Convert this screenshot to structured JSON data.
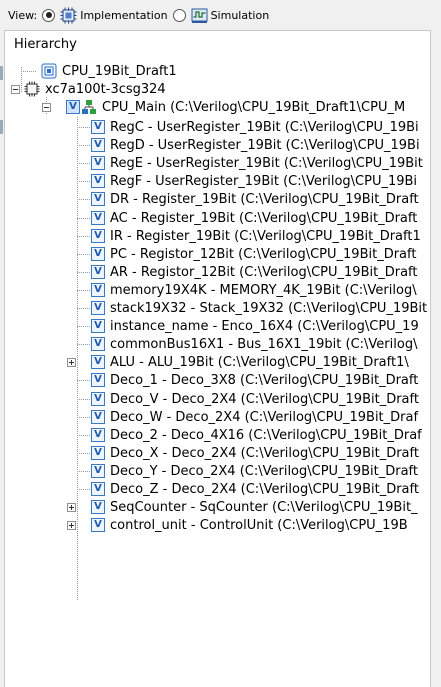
{
  "toolbar": {
    "view_label": "View:",
    "options": [
      {
        "label": "Implementation",
        "selected": true,
        "icon": "implementation-chip-icon"
      },
      {
        "label": "Simulation",
        "selected": false,
        "icon": "simulation-icon"
      }
    ]
  },
  "hierarchy": {
    "heading": "Hierarchy",
    "project": {
      "label": "CPU_19Bit_Draft1",
      "icon": "project-icon"
    },
    "device": {
      "label": "xc7a100t-3csg324",
      "icon": "chip-icon",
      "expanded": true
    },
    "top_module": {
      "label": "CPU_Main (C:\\Verilog\\CPU_19Bit_Draft1\\CPU_M",
      "icon": "verilog-top-module-icon",
      "expanded": true
    },
    "children": [
      {
        "label": "RegC - UserRegister_19Bit (C:\\Verilog\\CPU_19Bi",
        "expandable": false
      },
      {
        "label": "RegD - UserRegister_19Bit (C:\\Verilog\\CPU_19Bi",
        "expandable": false
      },
      {
        "label": "RegE - UserRegister_19Bit (C:\\Verilog\\CPU_19Bit",
        "expandable": false
      },
      {
        "label": "RegF - UserRegister_19Bit (C:\\Verilog\\CPU_19Bi",
        "expandable": false
      },
      {
        "label": "DR - Register_19Bit (C:\\Verilog\\CPU_19Bit_Draft",
        "expandable": false
      },
      {
        "label": "AC - Register_19Bit (C:\\Verilog\\CPU_19Bit_Draft",
        "expandable": false
      },
      {
        "label": "IR - Register_19Bit (C:\\Verilog\\CPU_19Bit_Draft1",
        "expandable": false
      },
      {
        "label": "PC - Registor_12Bit (C:\\Verilog\\CPU_19Bit_Draft",
        "expandable": false
      },
      {
        "label": "AR - Registor_12Bit (C:\\Verilog\\CPU_19Bit_Draft",
        "expandable": false
      },
      {
        "label": "memory19X4K - MEMORY_4K_19Bit (C:\\Verilog\\",
        "expandable": false
      },
      {
        "label": "stack19X32 - Stack_19X32 (C:\\Verilog\\CPU_19Bit",
        "expandable": false
      },
      {
        "label": "instance_name - Enco_16X4 (C:\\Verilog\\CPU_19",
        "expandable": false
      },
      {
        "label": "commonBus16X1 - Bus_16X1_19bit (C:\\Verilog\\",
        "expandable": false
      },
      {
        "label": "ALU - ALU_19Bit (C:\\Verilog\\CPU_19Bit_Draft1\\",
        "expandable": true
      },
      {
        "label": "Deco_1 - Deco_3X8 (C:\\Verilog\\CPU_19Bit_Draft",
        "expandable": false
      },
      {
        "label": "Deco_V - Deco_2X4 (C:\\Verilog\\CPU_19Bit_Draft",
        "expandable": false
      },
      {
        "label": "Deco_W - Deco_2X4 (C:\\Verilog\\CPU_19Bit_Draf",
        "expandable": false
      },
      {
        "label": "Deco_2 - Deco_4X16 (C:\\Verilog\\CPU_19Bit_Draf",
        "expandable": false
      },
      {
        "label": "Deco_X - Deco_2X4 (C:\\Verilog\\CPU_19Bit_Draft",
        "expandable": false
      },
      {
        "label": "Deco_Y - Deco_2X4 (C:\\Verilog\\CPU_19Bit_Draft",
        "expandable": false
      },
      {
        "label": "Deco_Z - Deco_2X4 (C:\\Verilog\\CPU_19Bit_Draft",
        "expandable": false
      },
      {
        "label": "SeqCounter - SqCounter (C:\\Verilog\\CPU_19Bit_",
        "expandable": true
      },
      {
        "label": "control_unit - ControlUnit (C:\\Verilog\\CPU_19B",
        "expandable": true
      }
    ]
  },
  "colors": {
    "toolbar_bg": "#f0f0f0",
    "icon_blue": "#3a78c2",
    "tree_bg": "#ffffff"
  }
}
